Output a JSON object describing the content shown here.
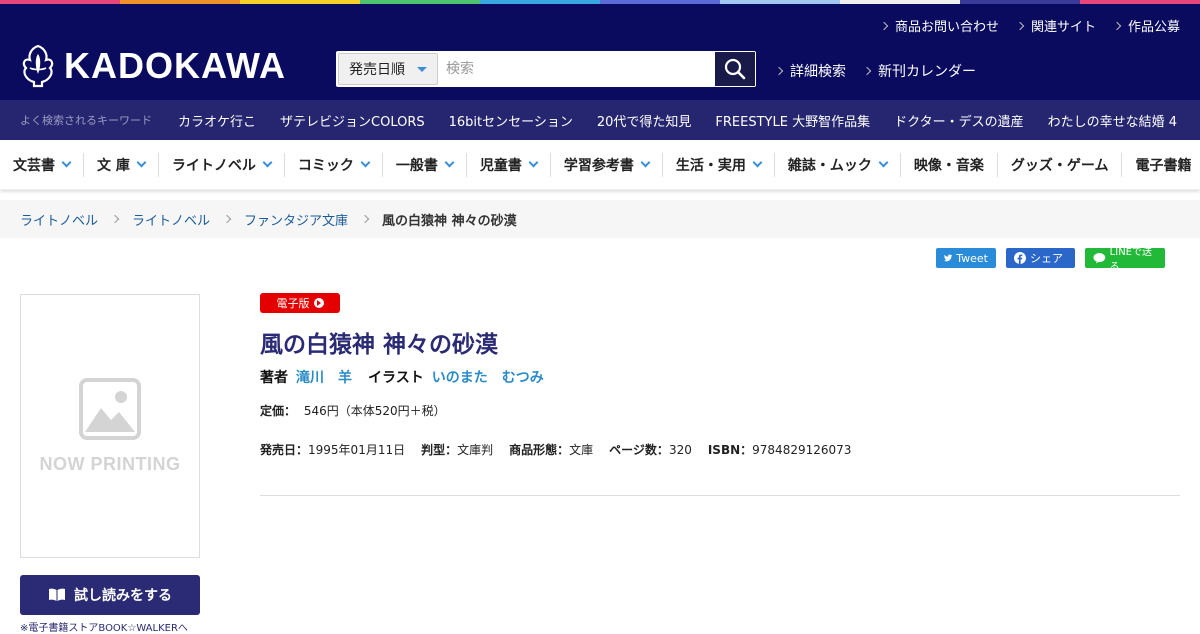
{
  "colors": {
    "header_bg": "#0a0a5e",
    "keyword_bar_bg": "#262670",
    "accent_blue": "#3a8fd8",
    "badge_red": "#e40000",
    "title_navy": "#2a2a75",
    "rainbow": [
      "#e8467c",
      "#f0922a",
      "#f5d22a",
      "#4fc26e",
      "#3aa7e0",
      "#5a6ad8",
      "#a0c8f0",
      "#f0f0f0",
      "#3a3a9a",
      "#e8467c"
    ]
  },
  "header": {
    "top_links": [
      "商品お問い合わせ",
      "関連サイト",
      "作品公募"
    ],
    "logo_text": "KADOKAWA",
    "search": {
      "select_value": "発売日順",
      "placeholder": "検索"
    },
    "adv_links": [
      "詳細検索",
      "新刊カレンダー"
    ]
  },
  "keywords": {
    "label": "よく検索されるキーワード",
    "items": [
      "カラオケ行こ",
      "ザテレビジョンCOLORS",
      "16bitセンセーション",
      "20代で得た知見",
      "FREESTYLE 大野智作品集",
      "ドクター・デスの遺産",
      "わたしの幸せな結婚 4"
    ]
  },
  "categories": [
    {
      "label": "文芸書",
      "dropdown": true
    },
    {
      "label": "文 庫",
      "dropdown": true
    },
    {
      "label": "ライトノベル",
      "dropdown": true
    },
    {
      "label": "コミック",
      "dropdown": true
    },
    {
      "label": "一般書",
      "dropdown": true
    },
    {
      "label": "児童書",
      "dropdown": true
    },
    {
      "label": "学習参考書",
      "dropdown": true
    },
    {
      "label": "生活・実用",
      "dropdown": true
    },
    {
      "label": "雑誌・ムック",
      "dropdown": true
    },
    {
      "label": "映像・音楽",
      "dropdown": false
    },
    {
      "label": "グッズ・ゲーム",
      "dropdown": false
    },
    {
      "label": "電子書籍",
      "dropdown": false
    }
  ],
  "breadcrumb": {
    "items": [
      "ライトノベル",
      "ライトノベル",
      "ファンタジア文庫"
    ],
    "current": "風の白猿神 神々の砂漠"
  },
  "share": {
    "tweet": "Tweet",
    "facebook": "シェア",
    "line": "LINEで送る"
  },
  "product": {
    "badge": "電子版",
    "cover_placeholder": "NOW PRINTING",
    "title": "風の白猿神 神々の砂漠",
    "author_label": "著者",
    "author": "滝川　羊",
    "illustrator_label": "イラスト",
    "illustrator": "いのまた　むつみ",
    "price_label": "定価：",
    "price": "546円（本体520円＋税）",
    "meta": [
      {
        "label": "発売日：",
        "value": "1995年01月11日"
      },
      {
        "label": "判型：",
        "value": "文庫判"
      },
      {
        "label": "商品形態：",
        "value": "文庫"
      },
      {
        "label": "ページ数：",
        "value": "320"
      },
      {
        "label": "ISBN：",
        "value": "9784829126073"
      }
    ],
    "trial_button": "試し読みをする",
    "trial_note": "※電子書籍ストアBOOK☆WALKERへ"
  }
}
